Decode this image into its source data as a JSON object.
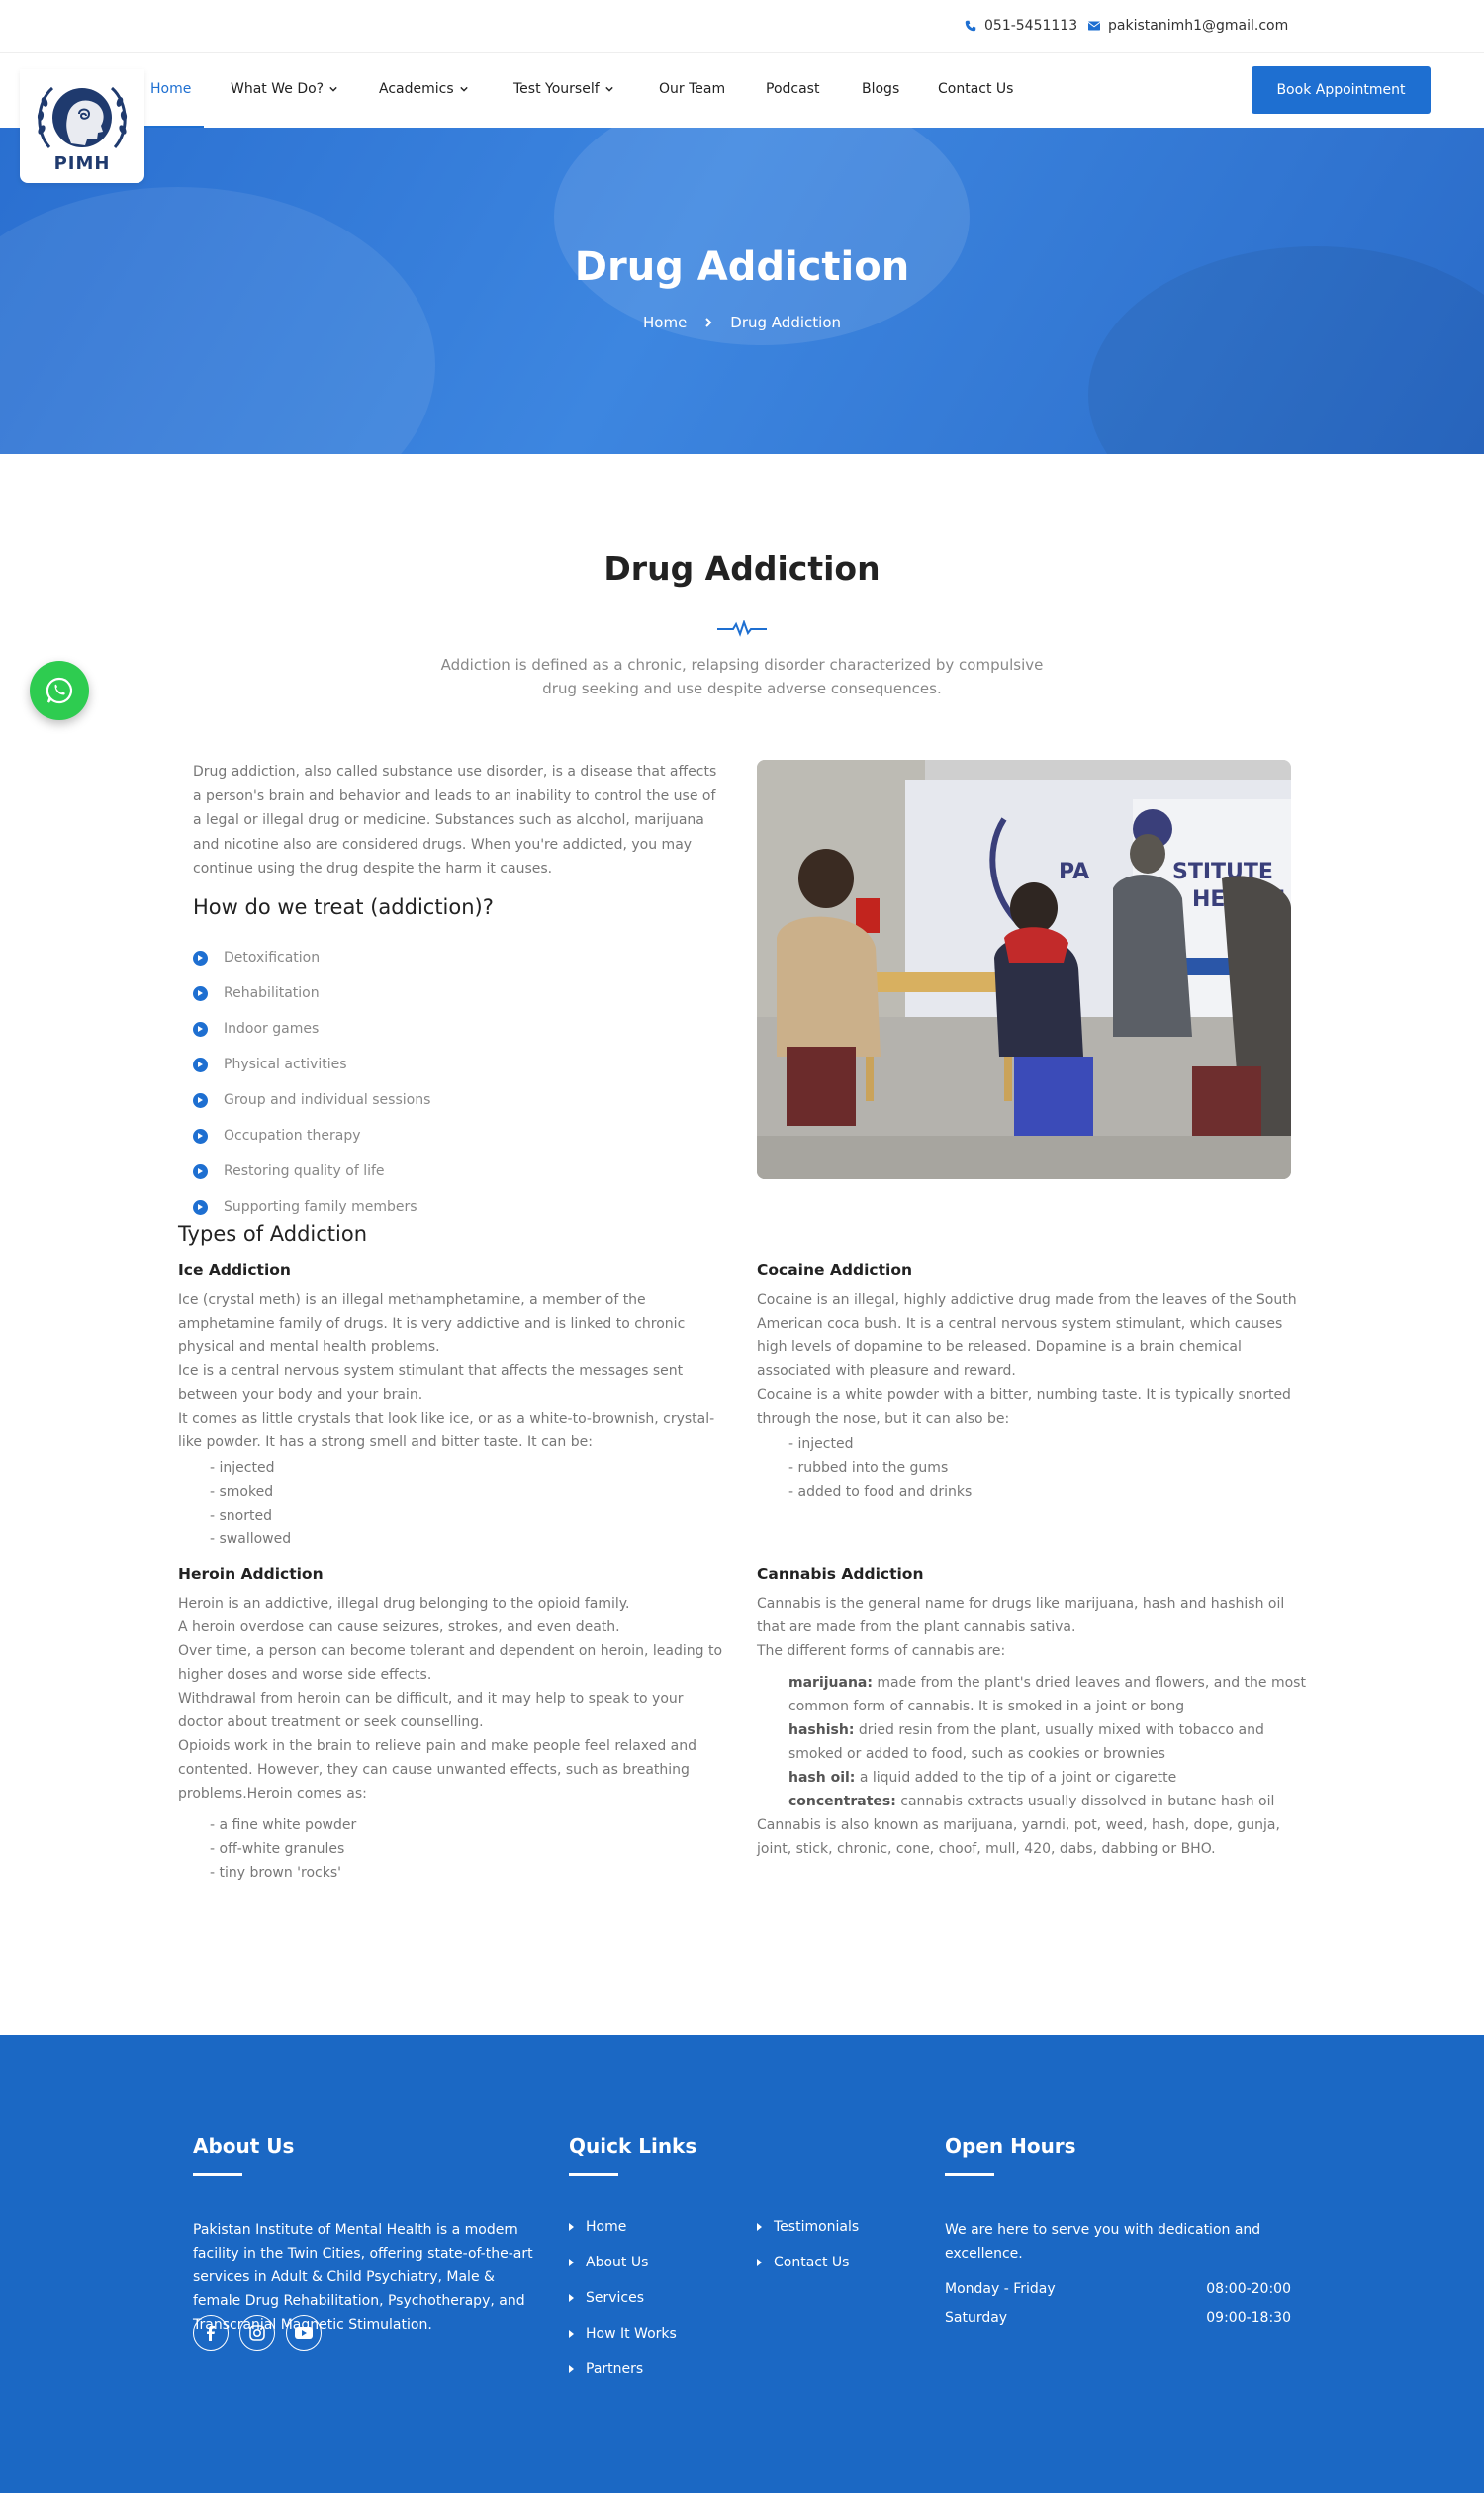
{
  "topbar": {
    "phone": "051-5451113",
    "email": "pakistanimh1@gmail.com"
  },
  "logo": {
    "text": "PIMH"
  },
  "nav": {
    "items": [
      {
        "label": "Home"
      },
      {
        "label": "What We Do?"
      },
      {
        "label": "Academics"
      },
      {
        "label": "Test Yourself"
      },
      {
        "label": "Our Team"
      },
      {
        "label": "Podcast"
      },
      {
        "label": "Blogs"
      },
      {
        "label": "Contact Us"
      }
    ],
    "active": "Home",
    "cta": "Book Appointment"
  },
  "hero": {
    "title": "Drug Addiction",
    "breadcrumb": [
      "Home",
      "Drug Addiction"
    ]
  },
  "section": {
    "title": "Drug Addiction",
    "subtitle": "Addiction is defined as a chronic, relapsing disorder characterized by compulsive drug seeking and use despite adverse consequences."
  },
  "intro": "Drug addiction, also called substance use disorder, is a disease that affects a person's brain and behavior and leads to an inability to control the use of a legal or illegal drug or medicine. Substances such as alcohol, marijuana and nicotine also are considered drugs. When you're addicted, you may continue using the drug despite the harm it causes.",
  "treatment": {
    "title": "How do we treat (addiction)?",
    "items": [
      "Detoxification",
      "Rehabilitation",
      "Indoor games",
      "Physical activities",
      "Group and individual sessions",
      "Occupation therapy",
      "Restoring quality of life",
      "Supporting family members"
    ]
  },
  "photo": {
    "sign_text_1": "PA",
    "sign_text_2": "STITUTE",
    "sign_text_3": "HEALTH"
  },
  "types": {
    "title": "Types of Addiction",
    "ice": {
      "title": "Ice Addiction",
      "lines": [
        "Ice (crystal meth) is an illegal methamphetamine, a member of the amphetamine family of drugs. It is very addictive and is linked to chronic physical and mental health problems.",
        "Ice is a central nervous system stimulant that affects the messages sent between your body and your brain.",
        "It comes as little crystals that look like ice, or as a white-to-brownish, crystal-like powder. It has a strong smell and bitter taste. It can be:"
      ],
      "uses": [
        "- injected",
        "- smoked",
        "- snorted",
        "- swallowed"
      ]
    },
    "cocaine": {
      "title": "Cocaine Addiction",
      "lines": [
        "Cocaine is an illegal, highly addictive drug made from the leaves of the South American coca bush. It is a central nervous system stimulant, which causes high levels of dopamine to be released. Dopamine is a brain chemical associated with pleasure and reward.",
        "Cocaine is a white powder with a bitter, numbing taste. It is typically snorted through the nose, but it can also be:"
      ],
      "uses": [
        "- injected",
        "- rubbed into the gums",
        "- added to food and drinks"
      ]
    },
    "heroin": {
      "title": "Heroin Addiction",
      "lines": [
        "Heroin is an addictive, illegal drug belonging to the opioid family.",
        "A heroin overdose can cause seizures, strokes, and even death.",
        "Over time, a person can become tolerant and dependent on heroin, leading to higher doses and worse side effects.",
        "Withdrawal from heroin can be difficult, and it may help to speak to your doctor about treatment or seek counselling.",
        "Opioids work in the brain to relieve pain and make people feel relaxed and contented. However, they can cause unwanted effects, such as breathing problems.Heroin comes as:"
      ],
      "forms": [
        "- a fine white powder",
        "- off-white granules",
        "- tiny brown 'rocks'"
      ]
    },
    "cannabis": {
      "title": "Cannabis Addiction",
      "lines": [
        "Cannabis is the general name for drugs like marijuana, hash and hashish oil that are made from the plant cannabis sativa.",
        "The different forms of cannabis are:"
      ],
      "forms": [
        {
          "term": "marijuana:",
          "desc": " made from the plant's dried leaves and flowers, and the most common form of cannabis. It is smoked in a joint or bong"
        },
        {
          "term": "hashish:",
          "desc": " dried resin from the plant, usually mixed with tobacco and smoked or added to food, such as cookies or brownies"
        },
        {
          "term": "hash oil:",
          "desc": " a liquid added to the tip of a joint or cigarette"
        },
        {
          "term": "concentrates:",
          "desc": " cannabis extracts usually dissolved in butane hash oil"
        }
      ],
      "closing": "Cannabis is also known as marijuana, yarndi, pot, weed, hash, dope, gunja, joint, stick, chronic, cone, choof, mull, 420, dabs, dabbing or BHO."
    }
  },
  "footer": {
    "about_title": "About Us",
    "about_text": "Pakistan Institute of Mental Health is a modern facility in the Twin Cities, offering state-of-the-art services in Adult & Child Psychiatry, Male & female Drug Rehabilitation, Psychotherapy, and Transcranial Magnetic Stimulation.",
    "links_title": "Quick Links",
    "links_col1": [
      "Home",
      "About Us",
      "Services",
      "How It Works",
      "Partners"
    ],
    "links_col2": [
      "Testimonials",
      "Contact Us"
    ],
    "hours_title": "Open Hours",
    "hours_text": "We are here to serve you with dedication and excellence.",
    "hours": [
      {
        "day": "Monday - Friday",
        "time": "08:00-20:00"
      },
      {
        "day": "Saturday",
        "time": "09:00-18:30"
      }
    ],
    "social": [
      "facebook-icon",
      "instagram-icon",
      "youtube-icon"
    ]
  },
  "colors": {
    "accent": "#1e6fd1",
    "footer": "#1b68c4",
    "whatsapp": "#2ecc50"
  }
}
